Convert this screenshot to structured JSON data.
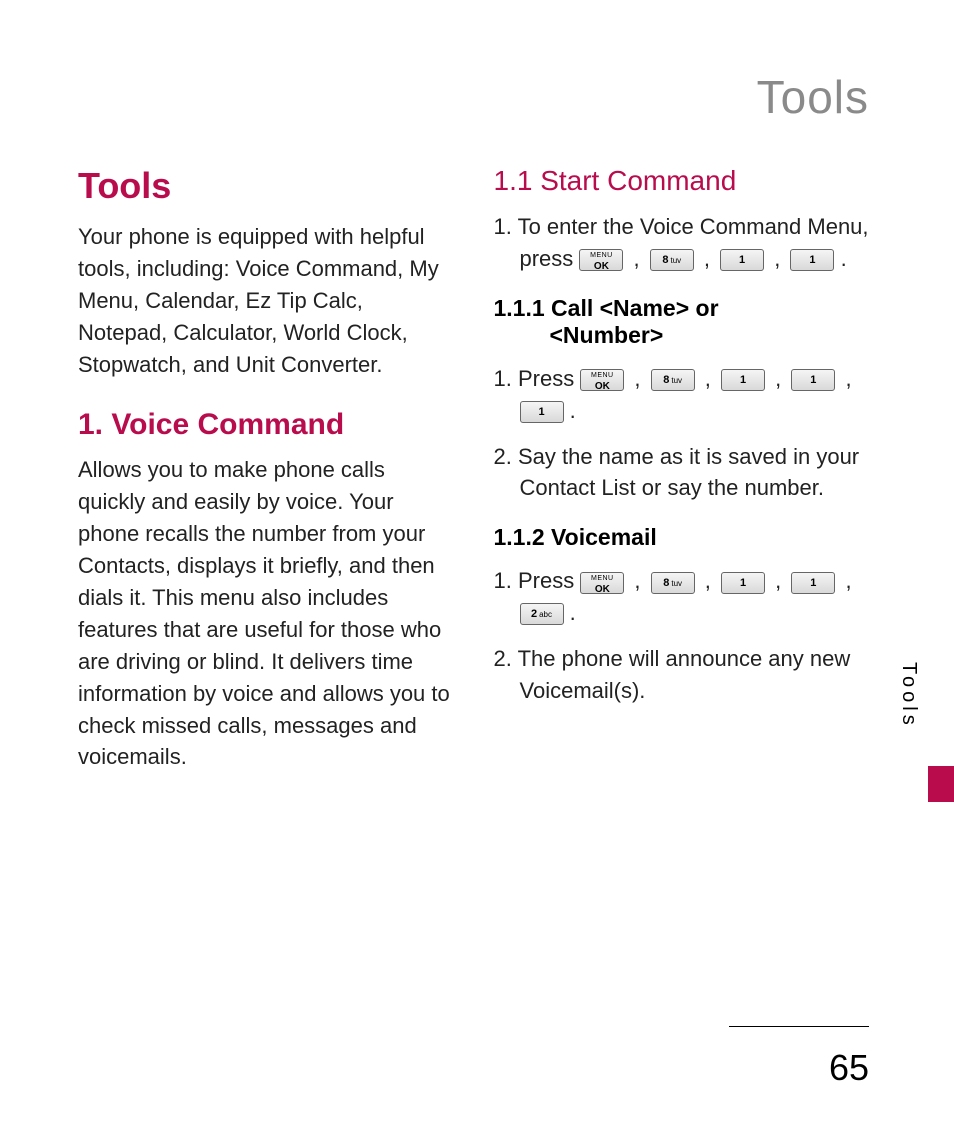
{
  "running_head": "Tools",
  "side_tab": "Tools",
  "page_number": "65",
  "keys": {
    "menu_ok_l1": "MENU",
    "menu_ok_l2": "OK",
    "k8": "8",
    "k8_sub": "tuv",
    "k1": "1",
    "k2": "2",
    "k2_sub": "abc"
  },
  "left": {
    "h1": "Tools",
    "intro": "Your phone is equipped with helpful tools, including: Voice Command, My Menu, Calendar, Ez Tip Calc, Notepad, Calculator, World Clock, Stopwatch, and Unit Converter.",
    "h2": "1. Voice Command",
    "voice_desc": "Allows you to make phone calls quickly and easily by voice. Your phone recalls the number from your Contacts, displays it briefly, and then dials it. This menu also includes features that are useful for those who are driving or blind. It delivers time information by voice and allows you to check missed calls, messages and voicemails."
  },
  "right": {
    "h3_start": "1.1 Start Command",
    "step1_prefix": "1. To enter the Voice Command Menu, press ",
    "h4_call_l1": "1.1.1 Call <Name> or",
    "h4_call_l2": "<Number>",
    "call_step1_prefix": "1. Press ",
    "call_step2": "2. Say the name as it is saved in your Contact List or say the number.",
    "h4_vm": "1.1.2 Voicemail",
    "vm_step1_prefix": "1. Press ",
    "vm_step2": "2. The phone will announce any new Voicemail(s).",
    "period": " .",
    "comma": " , "
  }
}
